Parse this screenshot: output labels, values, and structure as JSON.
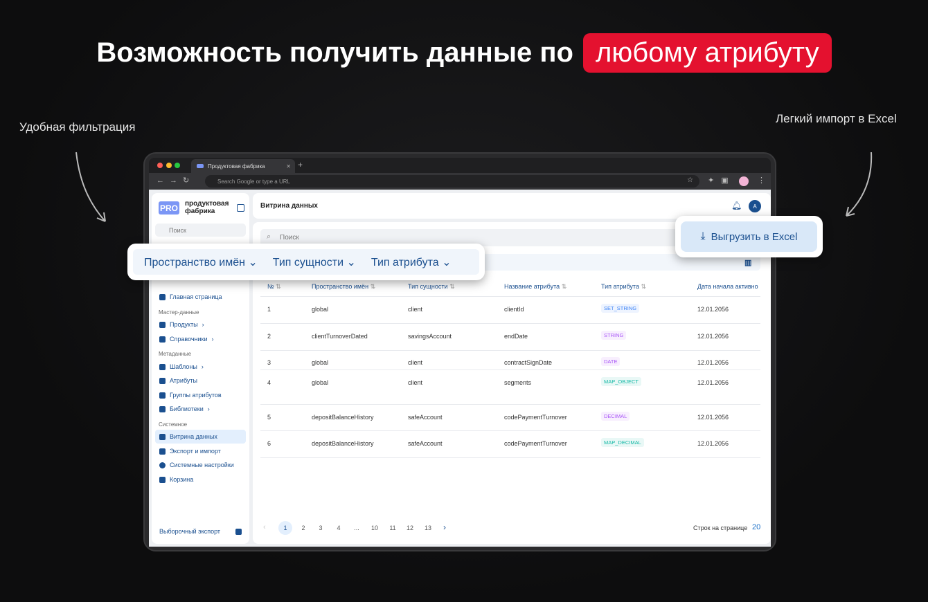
{
  "headline": {
    "text": "Возможность получить данные по",
    "highlight": "любому атрибуту"
  },
  "notes": {
    "left": "Удобная фильтрация",
    "right": "Легкий импорт в Excel"
  },
  "browser": {
    "tab_title": "Продуктовая фабрика",
    "url_placeholder": "Search Google or type a URL"
  },
  "sidebar": {
    "logo_badge": "PRO",
    "logo_line1": "продуктовая",
    "logo_line2": "фабрика",
    "search_placeholder": "Поиск",
    "home": "Главная страница",
    "sections": [
      "Мастер-данные",
      "Метаданные",
      "Системное"
    ],
    "items": [
      "Продукты",
      "Справочники",
      "Шаблоны",
      "Атрибуты",
      "Группы атрибутов",
      "Библиотеки",
      "Витрина данных",
      "Экспорт и импорт",
      "Системные настройки",
      "Корзина"
    ],
    "footer": "Выборочный экспорт"
  },
  "header": {
    "title": "Витрина данных",
    "avatar": "A"
  },
  "main": {
    "search_placeholder": "Поиск"
  },
  "filters": [
    "Пространство имён",
    "Тип сущности",
    "Тип атрибута"
  ],
  "export_button": "Выгрузить в Excel",
  "table": {
    "columns": [
      "№",
      "Пространство имён",
      "Тип сущности",
      "Название атрибута",
      "Тип атрибута",
      "Дата начала активно"
    ],
    "rows": [
      [
        "1",
        "global",
        "client",
        "clientId",
        "SET_STRING",
        "12.01.2056"
      ],
      [
        "2",
        "clientTurnoverDated",
        "savingsAccount",
        "endDate",
        "STRING",
        "12.01.2056"
      ],
      [
        "3",
        "global",
        "client",
        "contractSignDate",
        "DATE",
        "12.01.2056"
      ],
      [
        "4",
        "global",
        "client",
        "segments",
        "MAP_OBJECT",
        "12.01.2056"
      ],
      [
        "5",
        "depositBalanceHistory",
        "safeAccount",
        "codePaymentTurnover",
        "DECIMAL",
        "12.01.2056"
      ],
      [
        "6",
        "depositBalanceHistory",
        "safeAccount",
        "codePaymentTurnover",
        "MAP_DECIMAL",
        "12.01.2056"
      ]
    ]
  },
  "pagination": {
    "pages": [
      "1",
      "2",
      "3",
      "4",
      "...",
      "10",
      "11",
      "12",
      "13"
    ],
    "current": "1",
    "rows_label": "Строк на странице",
    "rows_value": "20"
  },
  "badge_colors": {
    "SET_STRING": "#3b82f6",
    "STRING": "#a855f7",
    "DATE": "#a855f7",
    "MAP_OBJECT": "#14b8a6",
    "DECIMAL": "#a855f7",
    "MAP_DECIMAL": "#14b8a6"
  }
}
